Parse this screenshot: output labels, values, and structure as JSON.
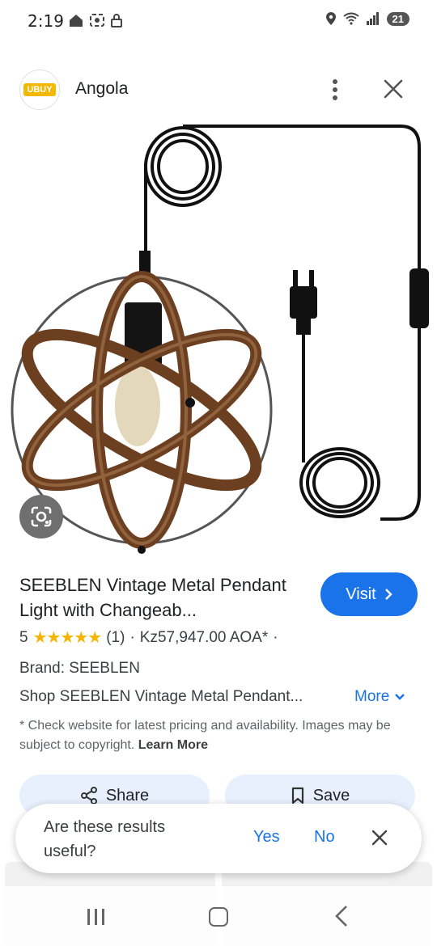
{
  "status_bar": {
    "time": "2:19",
    "battery": "21",
    "icons_left": [
      "home-icon",
      "screenshot-icon",
      "lock-icon"
    ],
    "icons_right": [
      "location-icon",
      "wifi-icon",
      "signal-icon",
      "battery-icon"
    ]
  },
  "header": {
    "logo_text": "UBUY",
    "site_name": "Angola"
  },
  "product": {
    "title": "SEEBLEN Vintage Metal Pendant Light with Changeab...",
    "visit_label": "Visit",
    "rating_value": "5",
    "stars": "★★★★★",
    "rating_count": "(1)",
    "separator": "·",
    "price": "Kz57,947.00 AOA*",
    "separator2": "·",
    "brand": "Brand: SEEBLEN",
    "description": "Shop SEEBLEN Vintage Metal Pendant...",
    "more_label": "More",
    "disclaimer": "* Check website for latest pricing and availability. Images may be subject to copyright.",
    "learn_more": "Learn More"
  },
  "actions": {
    "share_label": "Share",
    "save_label": "Save"
  },
  "feedback": {
    "question": "Are these results useful?",
    "yes_label": "Yes",
    "no_label": "No"
  },
  "colors": {
    "accent": "#1a73e8",
    "star": "#f4b400",
    "button_bg": "#e8f0fe"
  }
}
